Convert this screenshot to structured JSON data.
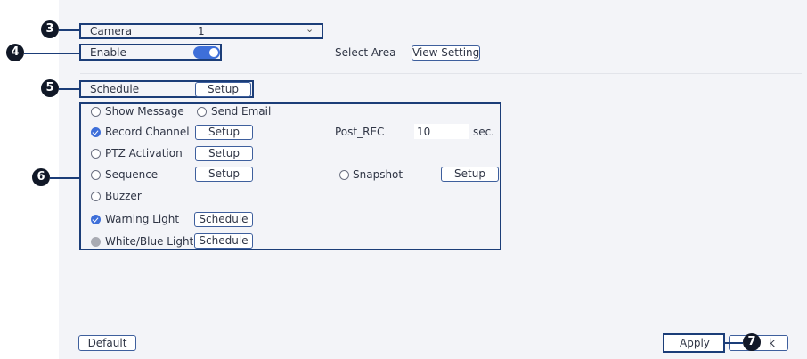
{
  "camera": {
    "label": "Camera",
    "value": "1"
  },
  "enable": {
    "label": "Enable",
    "on": true
  },
  "select_area": {
    "label": "Select Area",
    "button": "View Setting"
  },
  "schedule": {
    "label": "Schedule",
    "button": "Setup"
  },
  "actions": {
    "show_message": {
      "label": "Show Message",
      "checked": false
    },
    "send_email": {
      "label": "Send Email",
      "checked": false
    },
    "record_channel": {
      "label": "Record Channel",
      "checked": true,
      "button": "Setup"
    },
    "post_rec": {
      "label": "Post_REC",
      "value": "10",
      "unit": "sec."
    },
    "ptz_activation": {
      "label": "PTZ Activation",
      "checked": false,
      "button": "Setup"
    },
    "sequence": {
      "label": "Sequence",
      "checked": false,
      "button": "Setup"
    },
    "snapshot": {
      "label": "Snapshot",
      "checked": false,
      "button": "Setup"
    },
    "buzzer": {
      "label": "Buzzer",
      "checked": false
    },
    "warning_light": {
      "label": "Warning Light",
      "checked": true,
      "button": "Schedule"
    },
    "white_blue_light": {
      "label": "White/Blue Light",
      "checked": false,
      "disabled": true,
      "button": "Schedule"
    }
  },
  "footer": {
    "default": "Default",
    "apply": "Apply",
    "back": "k"
  },
  "callouts": [
    "3",
    "4",
    "5",
    "6",
    "7"
  ],
  "colors": {
    "highlight": "#1b3d78",
    "accent": "#3e6fd9",
    "panel": "#f3f4f8"
  }
}
